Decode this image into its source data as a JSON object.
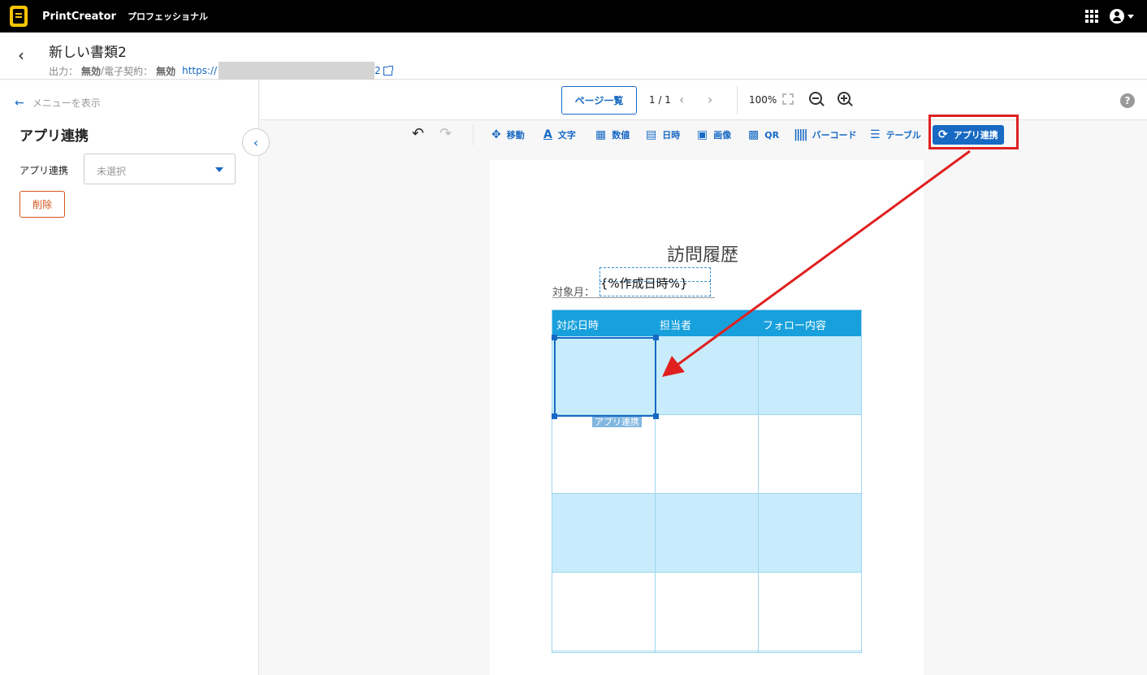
{
  "topbar": {
    "brand": "PrintCreator",
    "edition": "プロフェッショナル"
  },
  "doc": {
    "title": "新しい書類2",
    "output_label": "出力：",
    "output_value": "無効",
    "separator": " / ",
    "contract_label": "電子契約：",
    "contract_value": "無効",
    "url_prefix": "https://",
    "url_tail": "2"
  },
  "sidebar": {
    "show_menu": "メニューを表示",
    "title": "アプリ連携",
    "field_label": "アプリ連携",
    "select_value": "未選択",
    "delete_label": "削除"
  },
  "pagebar": {
    "page_list": "ページ一覧",
    "page_num": "1 / 1",
    "zoom": "100%",
    "help": "?"
  },
  "toolbar": {
    "move": "移動",
    "text": "文字",
    "number": "数値",
    "date": "日時",
    "image": "画像",
    "qr": "QR",
    "barcode": "バーコード",
    "table": "テーブル",
    "app_link": "アプリ連携"
  },
  "document": {
    "heading": "訪問履歴",
    "month_label": "対象月：",
    "placeholder": "{%作成日時%}",
    "columns": [
      "対応日時",
      "担当者",
      "フォロー内容"
    ],
    "cell_tag": "アプリ連携"
  },
  "colors": {
    "accent": "#1769c4",
    "header_blue": "#17a0dc",
    "row_shade": "#c8ecfb",
    "annotation_red": "#e02020"
  }
}
